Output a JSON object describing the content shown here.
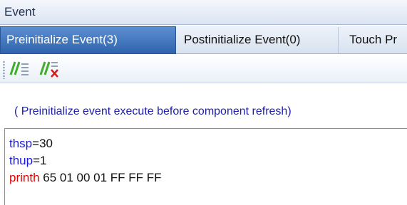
{
  "window": {
    "title": "Event"
  },
  "tabs": [
    {
      "label": "Preinitialize Event(3)",
      "active": true
    },
    {
      "label": "Postinitialize Event(0)",
      "active": false
    },
    {
      "label": "Touch Pr",
      "active": false
    }
  ],
  "toolbar": {
    "buttons": [
      {
        "icon": "comment-lines-icon",
        "color": "#3fae2a"
      },
      {
        "icon": "uncomment-lines-icon",
        "color": "#3fae2a"
      }
    ]
  },
  "hint": "( Preinitialize event execute before component refresh)",
  "editor": {
    "lines": [
      {
        "keyword": "thsp",
        "rest": "=30"
      },
      {
        "keyword": "thup",
        "rest": "=1"
      },
      {
        "keyword": "printh",
        "rest": " 65 01 00 01 FF FF FF"
      }
    ]
  },
  "colors": {
    "variable": "#1b1be0",
    "command": "#e00000",
    "hint": "#1f1fa8",
    "active_tab": "#3a70bd"
  }
}
